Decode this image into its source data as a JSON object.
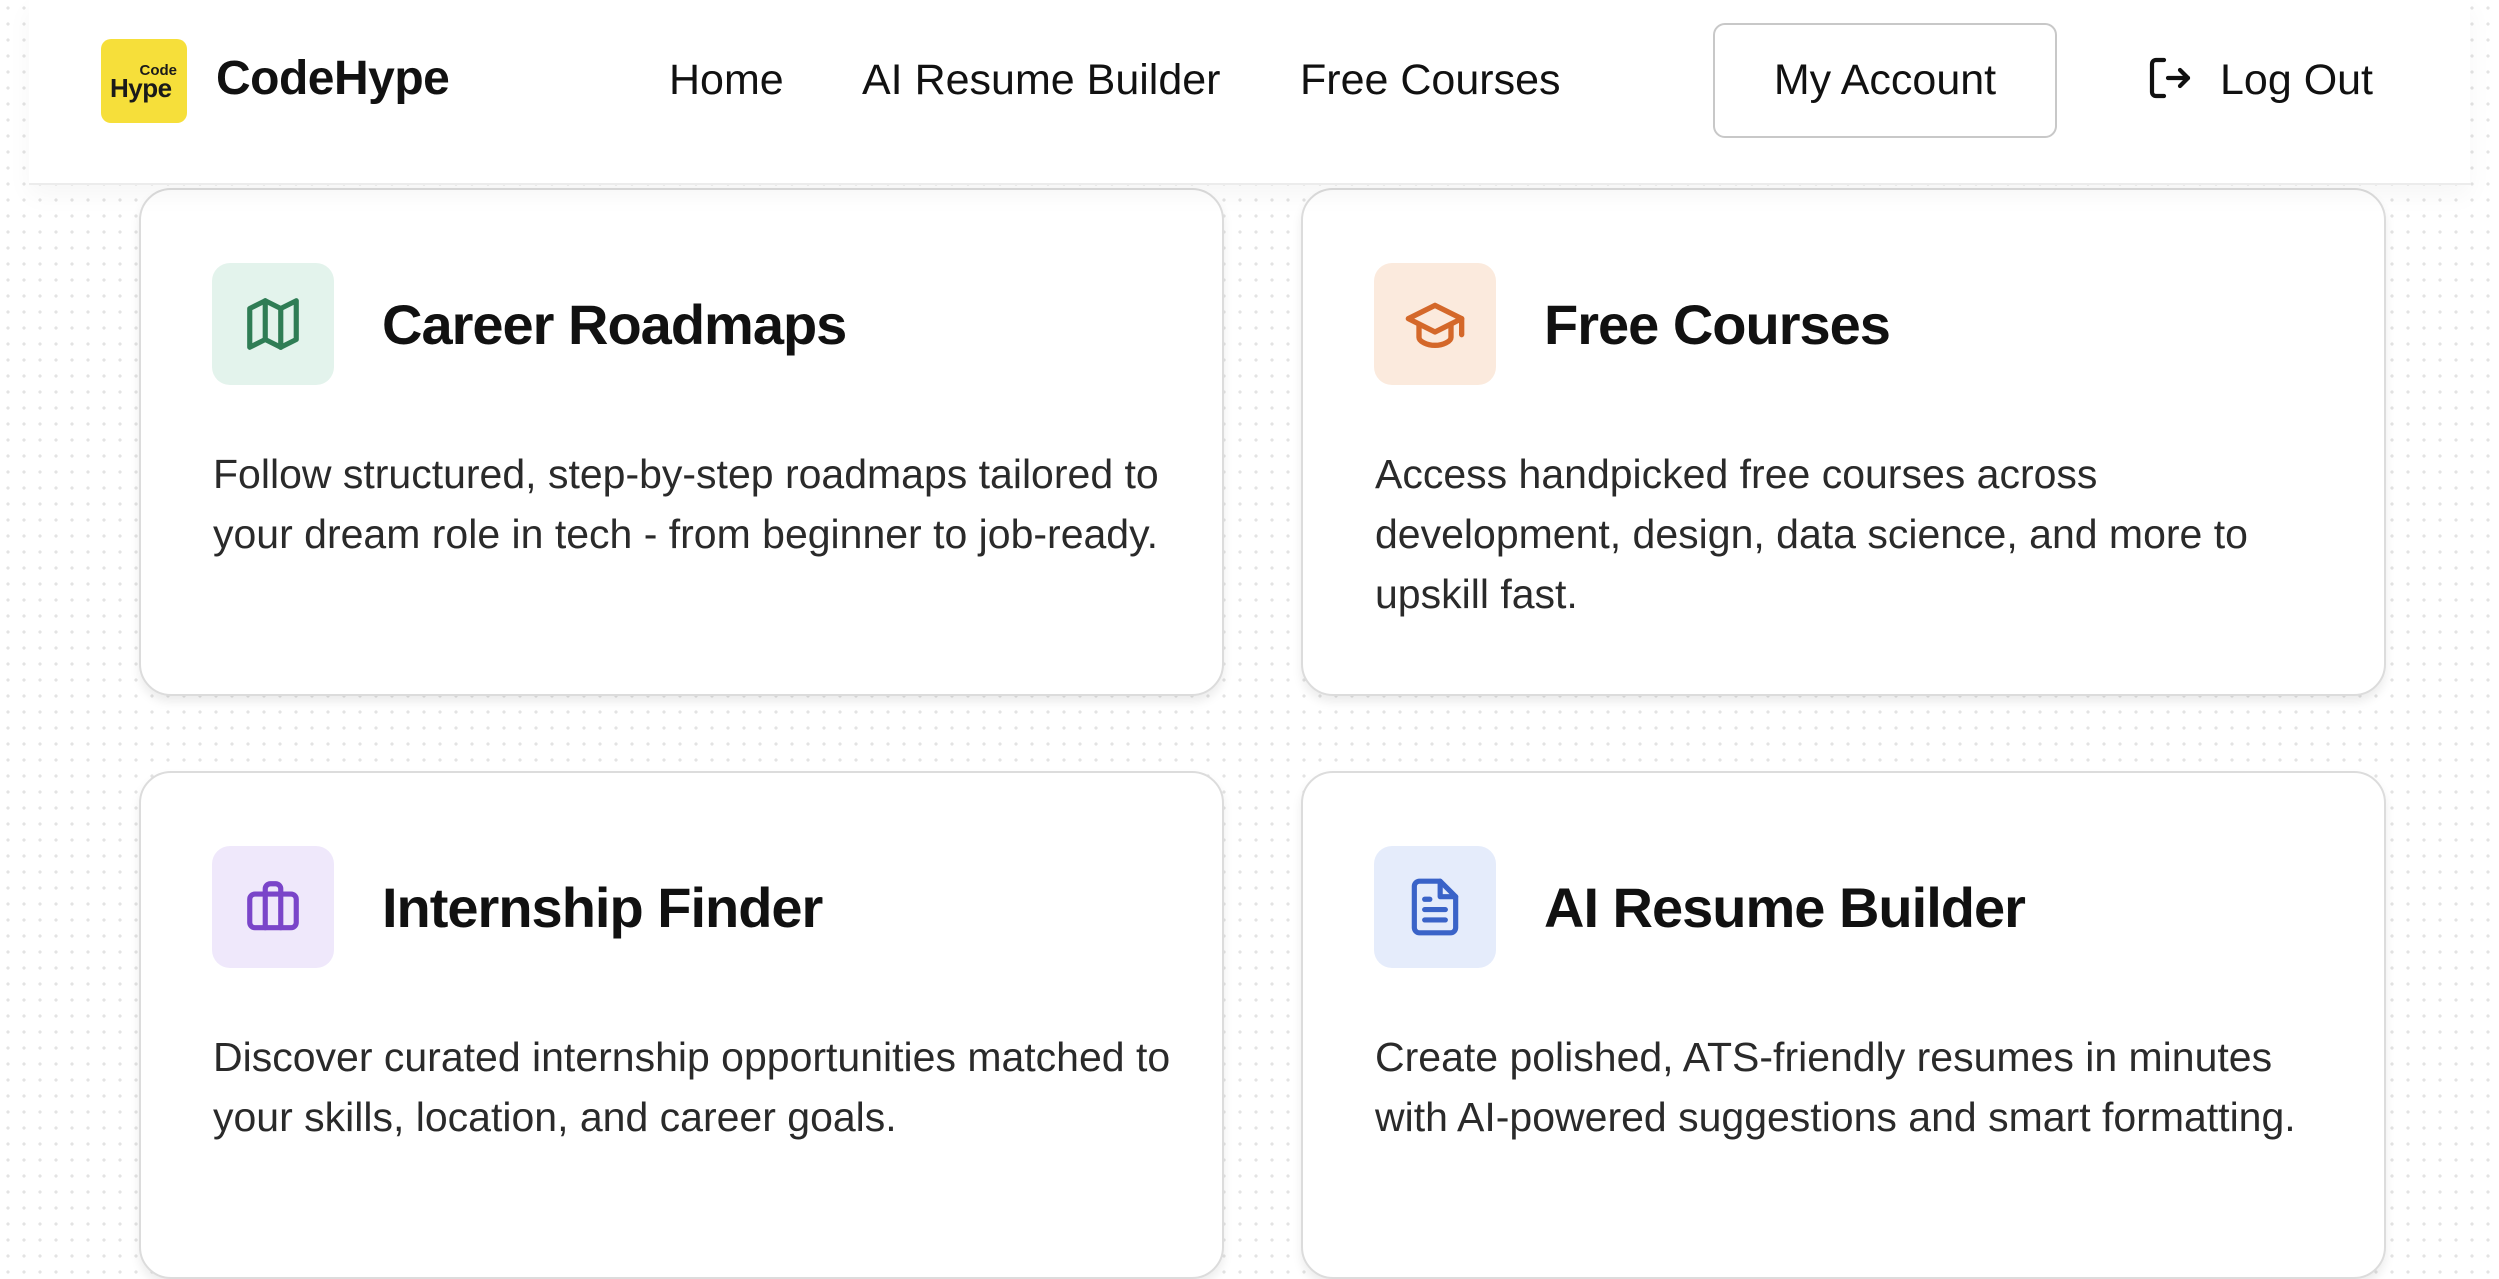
{
  "header": {
    "logo": {
      "top": "Code",
      "bottom": "Hype"
    },
    "brand": "CodeHype",
    "nav": [
      {
        "label": "Home"
      },
      {
        "label": "AI Resume Builder"
      },
      {
        "label": "Free Courses"
      }
    ],
    "account_label": "My Account",
    "logout_label": "Log Out"
  },
  "cards": [
    {
      "title": "Career Roadmaps",
      "description": "Follow structured, step-by-step roadmaps tailored to your dream role in tech - from beginner to job-ready.",
      "icon": "map-icon",
      "icon_color": "#2f7d55",
      "icon_bg": "#e3f3ec"
    },
    {
      "title": "Free Courses",
      "description": "Access handpicked free courses across development, design, data science, and more to upskill fast.",
      "icon": "graduation-cap-icon",
      "icon_color": "#d4682a",
      "icon_bg": "#fbeadd"
    },
    {
      "title": "Internship Finder",
      "description": "Discover curated internship opportunities matched to your skills, location, and career goals.",
      "icon": "briefcase-icon",
      "icon_color": "#7a45c9",
      "icon_bg": "#efe8fb"
    },
    {
      "title": "AI Resume Builder",
      "description": "Create polished, ATS-friendly resumes in minutes with AI-powered suggestions and smart formatting.",
      "icon": "document-icon",
      "icon_color": "#3a63c8",
      "icon_bg": "#e5ecfb"
    }
  ]
}
